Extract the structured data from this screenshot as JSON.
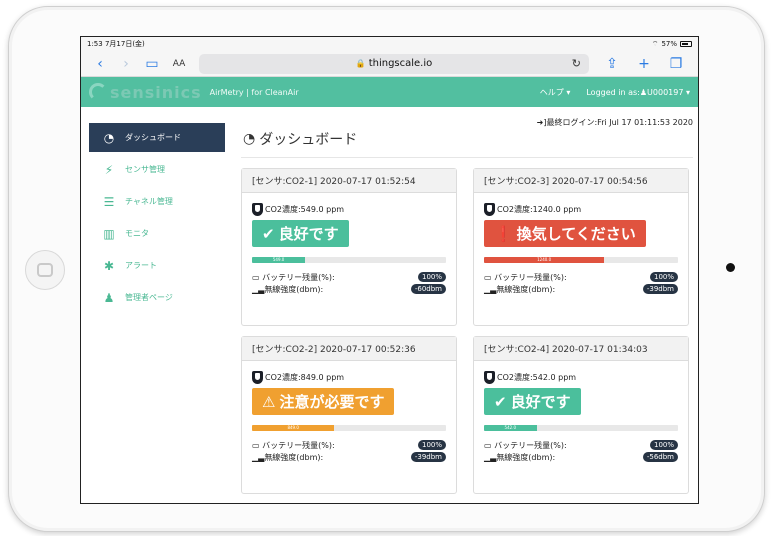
{
  "device": {
    "time": "1:53",
    "date": "7月17日(金)",
    "battery": "57%"
  },
  "browser": {
    "aa": "AA",
    "url": "thingscale.io"
  },
  "navbar": {
    "logo": "sensinics",
    "subtitle": "AirMetry | for CleanAir",
    "help": "ヘルプ ▾",
    "logged_in": "Logged in as:♟U000197 ▾"
  },
  "sidebar": {
    "items": [
      {
        "label": "ダッシュボード",
        "icon": "dashboard-icon",
        "active": true
      },
      {
        "label": "センサ管理",
        "icon": "plug-icon"
      },
      {
        "label": "チャネル管理",
        "icon": "database-icon"
      },
      {
        "label": "モニタ",
        "icon": "bar-chart-icon"
      },
      {
        "label": "アラート",
        "icon": "gear-icon"
      },
      {
        "label": "管理者ページ",
        "icon": "user-icon"
      }
    ]
  },
  "main": {
    "last_login": "➜]最終ログイン:Fri Jul 17 01:11:53 2020",
    "title": "ダッシュボード"
  },
  "cards": [
    {
      "header": "[センサ:CO2-1] 2020-07-17 01:52:54",
      "co2": "CO2濃度:549.0 ppm",
      "status": "良好です",
      "status_icon": "✔",
      "status_color": "#4bbf9c",
      "progress_value": 549.0,
      "progress_label": "549.0",
      "progress_color": "#4bbf9c",
      "battery_label": "バッテリー残量(%):",
      "battery": "100%",
      "signal_label": "無線強度(dbm):",
      "signal": "-60dbm"
    },
    {
      "header": "[センサ:CO2-3] 2020-07-17 00:54:56",
      "co2": "CO2濃度:1240.0 ppm",
      "status": "換気してください",
      "status_icon": "❗",
      "status_color": "#e0533f",
      "progress_value": 1240.0,
      "progress_label": "1240.0",
      "progress_color": "#e0533f",
      "battery_label": "バッテリー残量(%):",
      "battery": "100%",
      "signal_label": "無線強度(dbm):",
      "signal": "-39dbm"
    },
    {
      "header": "[センサ:CO2-2] 2020-07-17 00:52:36",
      "co2": "CO2濃度:849.0 ppm",
      "status": "注意が必要です",
      "status_icon": "⚠",
      "status_color": "#f0a030",
      "progress_value": 849.0,
      "progress_label": "849.0",
      "progress_color": "#f0a030",
      "battery_label": "バッテリー残量(%):",
      "battery": "100%",
      "signal_label": "無線強度(dbm):",
      "signal": "-39dbm"
    },
    {
      "header": "[センサ:CO2-4] 2020-07-17 01:34:03",
      "co2": "CO2濃度:542.0 ppm",
      "status": "良好です",
      "status_icon": "✔",
      "status_color": "#4bbf9c",
      "progress_value": 542.0,
      "progress_label": "542.0",
      "progress_color": "#4bbf9c",
      "battery_label": "バッテリー残量(%):",
      "battery": "100%",
      "signal_label": "無線強度(dbm):",
      "signal": "-56dbm"
    }
  ]
}
